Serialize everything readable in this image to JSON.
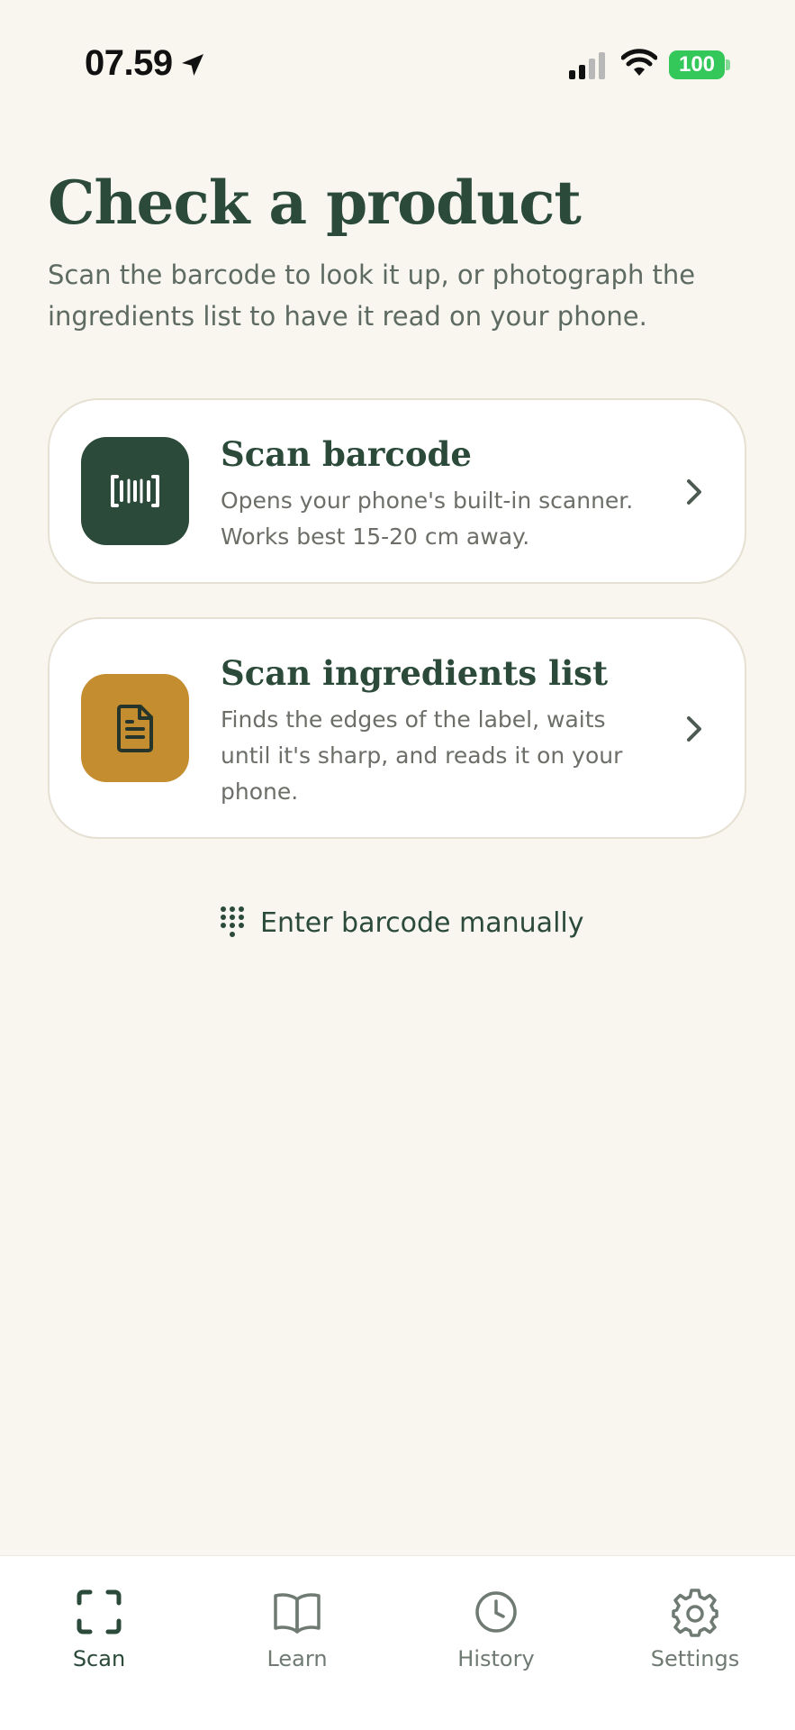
{
  "status_bar": {
    "time": "07.59",
    "battery": "100"
  },
  "header": {
    "title": "Check a product",
    "subtitle": "Scan the barcode to look it up, or photograph the ingredients list to have it read on your phone."
  },
  "options": [
    {
      "title": "Scan barcode",
      "description": "Opens your phone's built-in scanner. Works best 15-20 cm away.",
      "icon": "barcode-icon",
      "icon_color": "#2b4a3a"
    },
    {
      "title": "Scan ingredients list",
      "description": "Finds the edges of the label, waits until it's sharp, and reads it on your phone.",
      "icon": "document-icon",
      "icon_color": "#c48d30"
    }
  ],
  "manual_entry": {
    "label": "Enter barcode manually",
    "icon": "keypad-icon"
  },
  "tab_bar": {
    "tabs": [
      {
        "label": "Scan",
        "icon": "scan-frame-icon",
        "active": true
      },
      {
        "label": "Learn",
        "icon": "book-icon",
        "active": false
      },
      {
        "label": "History",
        "icon": "clock-icon",
        "active": false
      },
      {
        "label": "Settings",
        "icon": "gear-icon",
        "active": false
      }
    ]
  },
  "colors": {
    "background": "#f8f6ef",
    "primary": "#2b4a3a",
    "accent": "#c48d30",
    "battery": "#34c759"
  }
}
